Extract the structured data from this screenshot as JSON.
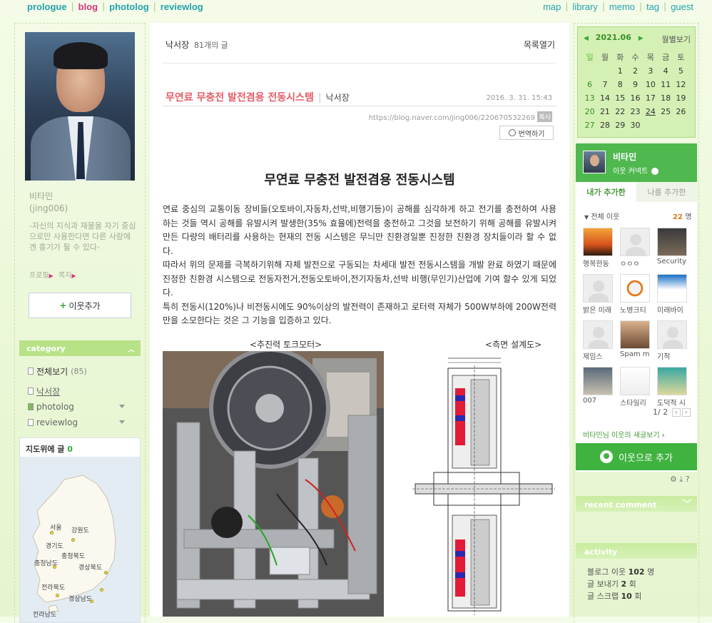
{
  "nav": {
    "left": [
      "prologue",
      "blog",
      "photolog",
      "reviewlog"
    ],
    "right": [
      "map",
      "library",
      "memo",
      "tag",
      "guest"
    ]
  },
  "profile": {
    "name": "비타민",
    "id": "(jing006)",
    "description": "-자신의 지식과 재물을 자기 중심으로만 사용한다면 다른 사람에겐 흉기가 될 수 있다-",
    "link_profile": "프로필",
    "link_note": "쪽지",
    "add_neighbor": "이웃추가"
  },
  "category": {
    "header": "category",
    "items": [
      {
        "label": "전체보기",
        "count": "(85)"
      },
      {
        "label": "낙서장",
        "count": ""
      },
      {
        "label": "photolog",
        "count": ""
      },
      {
        "label": "reviewlog",
        "count": ""
      }
    ]
  },
  "map": {
    "title": "지도위에 글",
    "count": "0",
    "regions": [
      "서울",
      "강원도",
      "경기도",
      "충청북도",
      "충청남도",
      "경상북도",
      "전라북도",
      "경상남도",
      "전라남도"
    ]
  },
  "post": {
    "blog_name": "낙서장",
    "post_count": "81개의 글",
    "toc": "목록열기",
    "title": "무연료 무충전 발전겸용 전동시스템",
    "category": "낙서장",
    "date": "2016. 3. 31. 15:43",
    "url": "https://blog.naver.com/jing006/220670532269",
    "copy": "복사",
    "translate": "번역하기",
    "heading": "무연료 무충전 발전겸용 전동시스템",
    "paragraphs": [
      " 연료 중심의 교통이동 장비들(오토바이,자동차,선박,비행기등)이 공해를 심각하게 하고 전기를 충전하여 사용 하는 것들 역시 공해를 유발시켜 발생한(35% 효율에)전력을 충전하고 그것을 보전하기 위해 공해를 유발시켜 만든 다량의 배터리를 사용하는 현재의 전동 시스템은 무늬만 친환경일뿐 진정한 친환경 장치들이라 할 수 없다.",
      " 따라서 위의 문제를 극복하기위해 자체 발전으로 구동되는 차세대 발전 전동시스템을 개발 완료 하였기 때문에 진정한 친환경 시스템으로 전동자전거,전동오토바이,전기자동차,선박 비행(무인기)산업에 기여 할수 있게 되었다.",
      " 특히 전동시(120%)나 비전동시에도 90%이상의 발전력이 존재하고 로터력 자체가 500W부하에 200W전력 만을 소모한다는 것은 그 기능을 입증하고 있다."
    ],
    "caption_left": "<추진력 토크모터>",
    "caption_right": "<측면 설계도>"
  },
  "calendar": {
    "month": "2021.06",
    "view": "월별보기",
    "weekdays": [
      "일",
      "월",
      "화",
      "수",
      "목",
      "금",
      "토"
    ],
    "days": [
      "",
      "",
      "1",
      "2",
      "3",
      "4",
      "5",
      "6",
      "7",
      "8",
      "9",
      "10",
      "11",
      "12",
      "13",
      "14",
      "15",
      "16",
      "17",
      "18",
      "19",
      "20",
      "21",
      "22",
      "23",
      "24",
      "25",
      "26",
      "27",
      "28",
      "29",
      "30",
      "",
      "",
      ""
    ]
  },
  "neighbors": {
    "name": "비타민",
    "cast": "이웃 커넥트",
    "tab_on": "내가 추가한",
    "tab_off": "나를 추가한",
    "all_label": "전체 이웃",
    "count": "22",
    "count_unit": "명",
    "items": [
      "행복한동",
      "ㅇㅇㅇ",
      "Security",
      "밝은 미래",
      "노병크티",
      "미래바이",
      "제임스",
      "Spam m",
      "기적",
      "007",
      "스타일리",
      "도덕적 시"
    ],
    "page": "1/ 2",
    "new_posts": "비타민님 이웃의 새글보기",
    "add_button": "이웃으로 추가"
  },
  "recent_comment": {
    "header": "recent comment"
  },
  "activity": {
    "header": "activity",
    "lines": [
      {
        "label": "블로그 이웃",
        "value": "102",
        "unit": "명"
      },
      {
        "label": "글 보내기",
        "value": "2",
        "unit": "회"
      },
      {
        "label": "글 스크랩",
        "value": "10",
        "unit": "회"
      }
    ]
  },
  "colors": {
    "nav": "#23a3ad",
    "active": "#d8357f",
    "title": "#e3606a",
    "green": "#3fb23f"
  }
}
